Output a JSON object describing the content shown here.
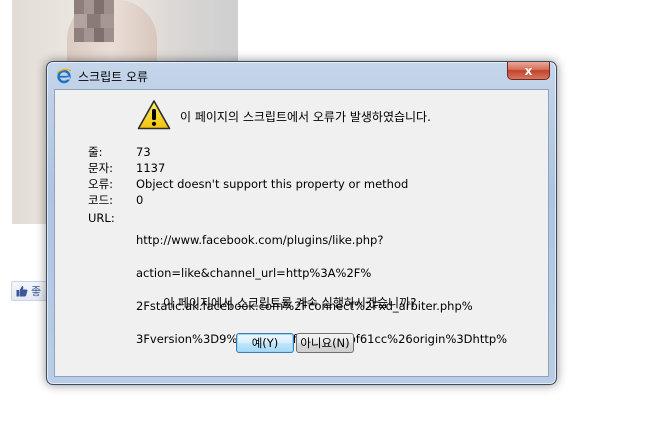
{
  "facebook_like": {
    "label": "좋"
  },
  "dialog": {
    "title": "스크립트 오류",
    "close_symbol": "x",
    "headline": "이 페이지의 스크립트에서 오류가 발생하였습니다.",
    "details": [
      {
        "label": "줄:",
        "value": "73"
      },
      {
        "label": "문자:",
        "value": "1137"
      },
      {
        "label": "오류:",
        "value": "Object doesn't support this property or method"
      },
      {
        "label": "코드:",
        "value": "0"
      }
    ],
    "url_label": "URL:",
    "url_lines": [
      "http://www.facebook.com/plugins/like.php?",
      "action=like&channel_url=http%3A%2F%",
      "2Fstatic.ak.facebook.com%2Fconnect%2Fxd_arbiter.php%",
      "3Fversion%3D9%23cb%3Df3a6fdf79bf61cc%26origin%3Dhttp%"
    ],
    "question": "이 페이지에서 스크립트를 계속 실행하시겠습니까?",
    "buttons": {
      "yes": "예(Y)",
      "no": "아니요(N)"
    }
  },
  "colors": {
    "dialog_frame": "#b9cde6",
    "close_button": "#c2422a",
    "client_background": "#f0f0f0",
    "warning_yellow": "#f7d21a",
    "facebook_blue": "#3b5998"
  },
  "icons": {
    "title": "ie-logo-icon",
    "warning": "warning-triangle-icon",
    "like": "thumbs-up-icon"
  }
}
